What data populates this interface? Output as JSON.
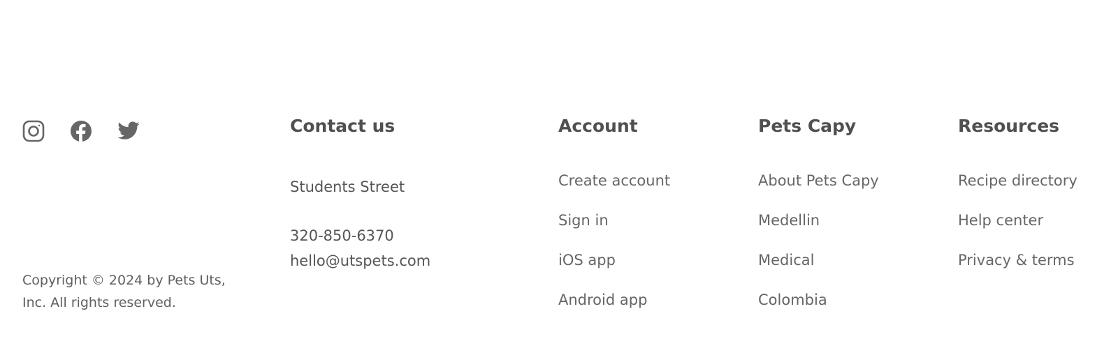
{
  "social": {
    "icons": [
      "instagram-icon",
      "facebook-icon",
      "twitter-icon"
    ]
  },
  "copyright": "Copyright © 2024 by Pets Uts, Inc. All rights reserved.",
  "contact": {
    "title": "Contact us",
    "street": "Students Street",
    "phone": "320-850-6370",
    "email": "hello@utspets.com"
  },
  "account": {
    "title": "Account",
    "items": [
      {
        "label": "Create account"
      },
      {
        "label": "Sign in"
      },
      {
        "label": "iOS app"
      },
      {
        "label": "Android app"
      }
    ]
  },
  "pets_capy": {
    "title": "Pets Capy",
    "items": [
      {
        "label": "About Pets Capy"
      },
      {
        "label": "Medellin"
      },
      {
        "label": "Medical"
      },
      {
        "label": "Colombia"
      }
    ]
  },
  "resources": {
    "title": "Resources",
    "items": [
      {
        "label": "Recipe directory"
      },
      {
        "label": "Help center"
      },
      {
        "label": "Privacy & terms"
      }
    ]
  },
  "colors": {
    "text": "#555555",
    "muted": "#666666",
    "background": "#ffffff"
  }
}
